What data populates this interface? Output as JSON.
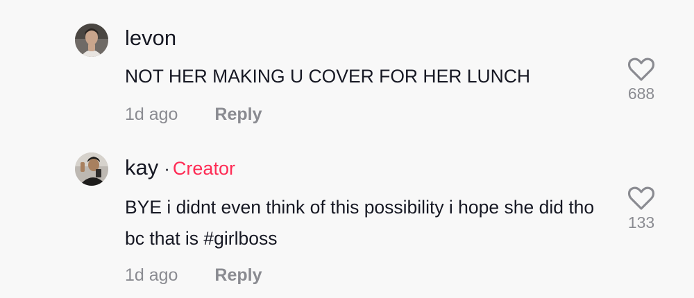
{
  "comments": [
    {
      "username": "levon",
      "text": "NOT HER MAKING U COVER FOR HER LUNCH",
      "time": "1d ago",
      "reply_label": "Reply",
      "likes": "688",
      "like_icon": "heart-outline-icon"
    },
    {
      "username": "kay",
      "separator": "·",
      "badge": "Creator",
      "text": "BYE i didnt even think of this possibility i hope she did tho bc that is #girlboss",
      "time": "1d ago",
      "reply_label": "Reply",
      "likes": "133",
      "like_icon": "heart-outline-icon"
    }
  ],
  "colors": {
    "background": "#f8f8f8",
    "text": "#161823",
    "muted": "#8a8b91",
    "creator_badge": "#fe2c55"
  }
}
